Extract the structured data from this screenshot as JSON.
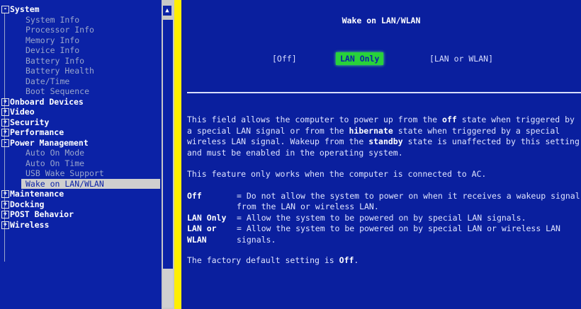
{
  "tree": {
    "items": [
      {
        "type": "category",
        "box": "-",
        "label": "System"
      },
      {
        "type": "child",
        "label": "System Info"
      },
      {
        "type": "child",
        "label": "Processor Info"
      },
      {
        "type": "child",
        "label": "Memory Info"
      },
      {
        "type": "child",
        "label": "Device Info"
      },
      {
        "type": "child",
        "label": "Battery Info"
      },
      {
        "type": "child",
        "label": "Battery Health"
      },
      {
        "type": "child",
        "label": "Date/Time"
      },
      {
        "type": "child",
        "label": "Boot Sequence"
      },
      {
        "type": "category",
        "box": "+",
        "label": "Onboard Devices"
      },
      {
        "type": "category",
        "box": "+",
        "label": "Video"
      },
      {
        "type": "category",
        "box": "+",
        "label": "Security"
      },
      {
        "type": "category",
        "box": "+",
        "label": "Performance"
      },
      {
        "type": "category",
        "box": "-",
        "label": "Power Management"
      },
      {
        "type": "child",
        "label": "Auto On Mode"
      },
      {
        "type": "child",
        "label": "Auto On Time"
      },
      {
        "type": "child",
        "label": "USB Wake Support"
      },
      {
        "type": "child",
        "label": "Wake on LAN/WLAN",
        "selected": true
      },
      {
        "type": "category",
        "box": "+",
        "label": "Maintenance"
      },
      {
        "type": "category",
        "box": "+",
        "label": "Docking"
      },
      {
        "type": "category",
        "box": "+",
        "label": "POST Behavior"
      },
      {
        "type": "category",
        "box": "+",
        "label": "Wireless"
      }
    ]
  },
  "scroll_arrow": "▲",
  "content": {
    "title": "Wake on LAN/WLAN",
    "options": [
      {
        "label": "[Off]",
        "selected": false
      },
      {
        "label": "LAN Only",
        "selected": true
      },
      {
        "label": "[LAN or WLAN]",
        "selected": false
      }
    ],
    "para1": {
      "t1": "This field allows the computer to power up from the ",
      "b1": "off",
      "t2": " state when triggered by a special LAN signal or from the ",
      "b2": "hibernate",
      "t3": " state when triggered by a special wireless LAN signal. Wakeup from the ",
      "b3": "standby",
      "t4": " state is unaffected by this setting and must be enabled in the operating system."
    },
    "para2": "This feature only works when the computer is connected to AC.",
    "definitions": [
      {
        "term": "Off",
        "text": "= Do not allow the system to power on when it receives a wakeup signal from the LAN or wireless LAN."
      },
      {
        "term": "LAN Only",
        "text": "= Allow the system to be powered on by special LAN signals."
      },
      {
        "term": "LAN or WLAN",
        "text": "= Allow the system to be powered on by special LAN or wireless LAN signals."
      }
    ],
    "factory": {
      "t1": "The factory default setting is ",
      "b1": "Off",
      "t2": "."
    }
  }
}
